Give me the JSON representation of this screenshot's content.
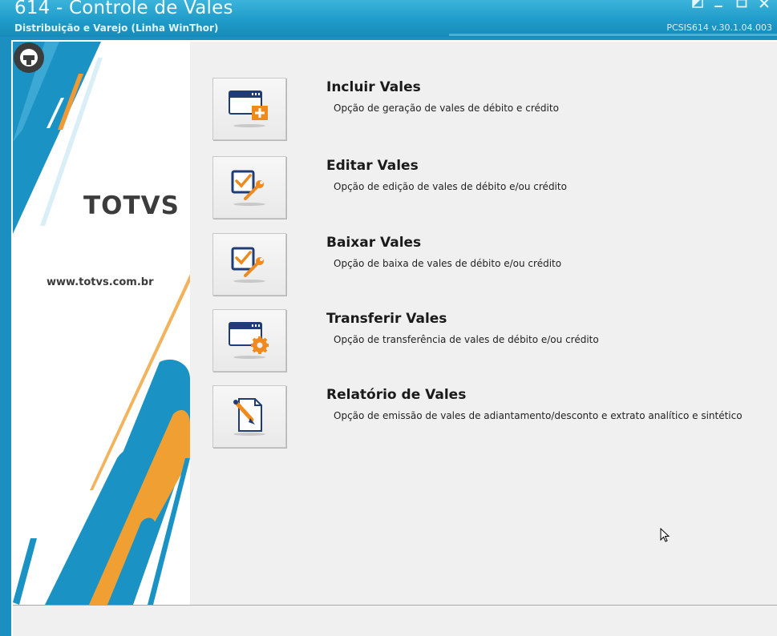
{
  "window": {
    "title": "614 - Controle de Vales",
    "subtitle": "Distribuição e Varejo (Linha WinThor)",
    "version": "PCSIS614  v.30.1.04.003"
  },
  "sidebar": {
    "logo_text": "TOTVS",
    "website": "www.totvs.com.br"
  },
  "menu": [
    {
      "title": "Incluir Vales",
      "description": "Opção de geração de vales de débito e crédito",
      "icon": "window-add-icon"
    },
    {
      "title": "Editar Vales",
      "description": "Opção de edição de vales de débito e/ou crédito",
      "icon": "checklist-wrench-icon"
    },
    {
      "title": "Baixar Vales",
      "description": "Opção de baixa de vales de débito e/ou crédito",
      "icon": "checklist-wrench-icon"
    },
    {
      "title": "Transferir Vales",
      "description": "Opção de transferência de vales de débito e/ou crédito",
      "icon": "window-gear-icon"
    },
    {
      "title": "Relatório de Vales",
      "description": "Opção de emissão de vales de adiantamento/desconto e extrato analítico e sintético",
      "icon": "document-pen-icon"
    }
  ],
  "colors": {
    "titlebar": "#1f9cc9",
    "brand_blue": "#1a93c4",
    "brand_orange": "#f0a033",
    "icon_blue": "#1f3c74",
    "icon_orange": "#f08a1c"
  }
}
